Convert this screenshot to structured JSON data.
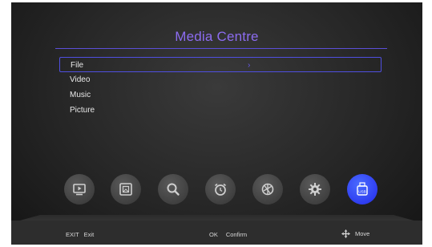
{
  "screen": {
    "title": "Media Centre"
  },
  "menu": {
    "items": [
      {
        "label": "File"
      },
      {
        "label": "Video"
      },
      {
        "label": "Music"
      },
      {
        "label": "Picture"
      }
    ],
    "selected_chevron": "›"
  },
  "toolbar": {
    "icons": [
      {
        "name": "media-play-icon"
      },
      {
        "name": "picture-frame-icon"
      },
      {
        "name": "search-icon"
      },
      {
        "name": "alarm-clock-icon"
      },
      {
        "name": "aperture-icon"
      },
      {
        "name": "settings-gear-icon"
      },
      {
        "name": "usb-icon",
        "label": "USB"
      }
    ]
  },
  "footer": {
    "exit_key": "EXIT",
    "exit_label": "Exit",
    "ok_key": "OK",
    "ok_label": "Confirm",
    "move_label": "Move"
  },
  "colors": {
    "title": "#8c6cf0",
    "accent": "#2f3df0",
    "selection_border": "#4f4fe0"
  }
}
